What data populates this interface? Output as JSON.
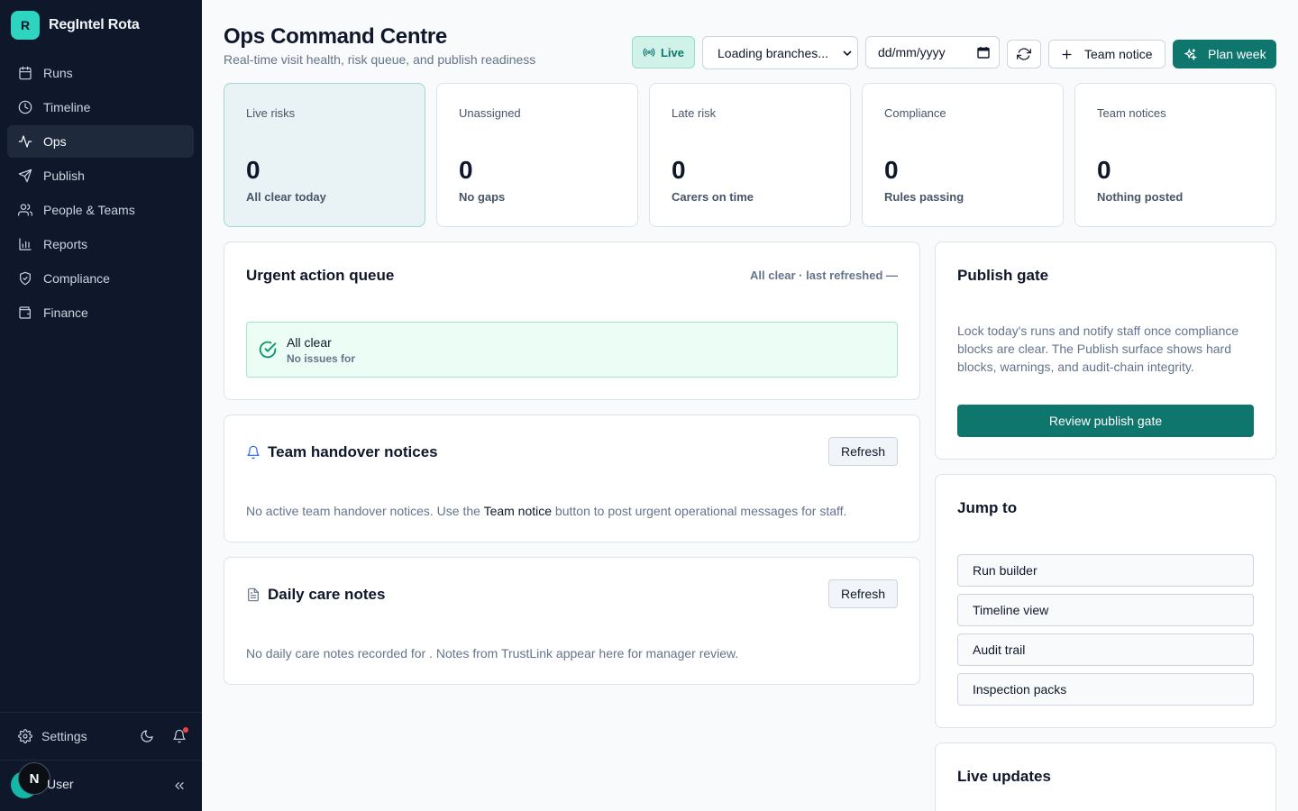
{
  "app": {
    "logo_letter": "R",
    "name": "RegIntel Rota"
  },
  "sidebar": {
    "items": [
      {
        "label": "Runs",
        "icon": "calendar-icon"
      },
      {
        "label": "Timeline",
        "icon": "clock-icon"
      },
      {
        "label": "Ops",
        "icon": "activity-icon",
        "active": true
      },
      {
        "label": "Publish",
        "icon": "send-icon"
      },
      {
        "label": "People & Teams",
        "icon": "users-icon"
      },
      {
        "label": "Reports",
        "icon": "bar-chart-icon"
      },
      {
        "label": "Compliance",
        "icon": "shield-check-icon"
      },
      {
        "label": "Finance",
        "icon": "wallet-icon"
      }
    ],
    "settings_label": "Settings",
    "user_initial": "N",
    "user_name": "User"
  },
  "header": {
    "title": "Ops Command Centre",
    "subtitle": "Real-time visit health, risk queue, and publish readiness",
    "live_label": "Live",
    "branch_select": "Loading branches...",
    "date_placeholder": "dd/mm/yyyy",
    "team_notice_label": "Team notice",
    "plan_week_label": "Plan week"
  },
  "kpis": [
    {
      "label": "Live risks",
      "value": "0",
      "sub": "All clear today"
    },
    {
      "label": "Unassigned",
      "value": "0",
      "sub": "No gaps"
    },
    {
      "label": "Late risk",
      "value": "0",
      "sub": "Carers on time"
    },
    {
      "label": "Compliance",
      "value": "0",
      "sub": "Rules passing"
    },
    {
      "label": "Team notices",
      "value": "0",
      "sub": "Nothing posted"
    }
  ],
  "urgent": {
    "title": "Urgent action queue",
    "meta": "All clear · last refreshed —",
    "clear_title": "All clear",
    "clear_sub": "No issues for"
  },
  "handover": {
    "title": "Team handover notices",
    "refresh_label": "Refresh",
    "text_before": "No active team handover notices. Use the ",
    "text_link": "Team notice",
    "text_after": " button to post urgent operational messages for staff."
  },
  "care_notes": {
    "title": "Daily care notes",
    "refresh_label": "Refresh",
    "text": "No daily care notes recorded for . Notes from TrustLink appear here for manager review."
  },
  "publish_gate": {
    "title": "Publish gate",
    "text": "Lock today's runs and notify staff once compliance blocks are clear. The Publish surface shows hard blocks, warnings, and audit-chain integrity.",
    "button_label": "Review publish gate"
  },
  "jump_to": {
    "title": "Jump to",
    "items": [
      "Run builder",
      "Timeline view",
      "Audit trail",
      "Inspection packs"
    ]
  },
  "live_updates": {
    "title": "Live updates"
  },
  "colors": {
    "sidebar_bg": "#0f172a",
    "accent": "#0f766e",
    "brand": "#2dd4bf",
    "success_bg": "#ecfdf5"
  }
}
